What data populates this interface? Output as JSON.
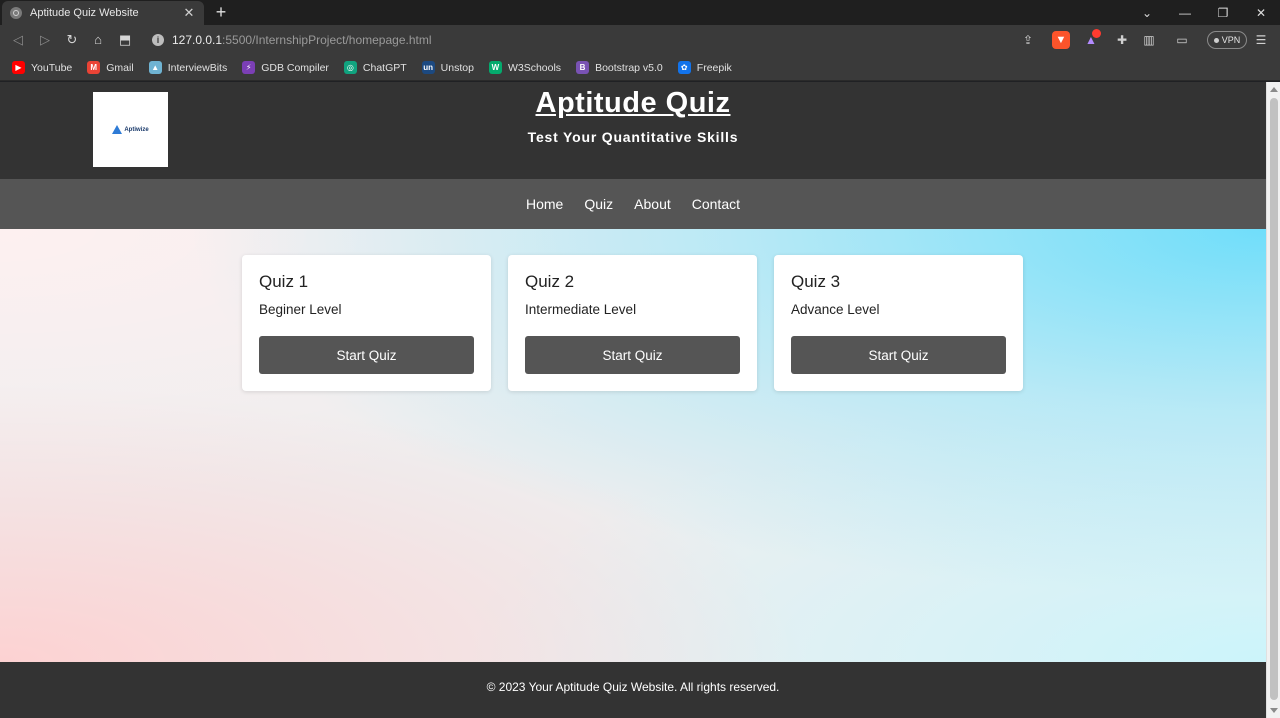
{
  "browser": {
    "tab_title": "Aptitude Quiz Website",
    "tab_close": "✕",
    "new_tab": "+",
    "url_host": "127.0.0.1",
    "url_rest": ":5500/InternshipProject/homepage.html",
    "vpn_label": "VPN",
    "bookmarks": [
      {
        "label": "YouTube",
        "icon": "youtube-icon",
        "color": "#ff0000"
      },
      {
        "label": "Gmail",
        "icon": "gmail-icon",
        "color": "#ea4335"
      },
      {
        "label": "InterviewBits",
        "icon": "interviewbit-icon",
        "color": "#6fb3d2"
      },
      {
        "label": "GDB Compiler",
        "icon": "gdb-icon",
        "color": "#7b3fb5"
      },
      {
        "label": "ChatGPT",
        "icon": "chatgpt-icon",
        "color": "#10a37f"
      },
      {
        "label": "Unstop",
        "icon": "unstop-icon",
        "color": "#1c4980"
      },
      {
        "label": "W3Schools",
        "icon": "w3schools-icon",
        "color": "#04aa6d"
      },
      {
        "label": "Bootstrap v5.0",
        "icon": "bootstrap-icon",
        "color": "#7952b3"
      },
      {
        "label": "Freepik",
        "icon": "freepik-icon",
        "color": "#1273eb"
      }
    ]
  },
  "site": {
    "logo_text": "Aptiwize",
    "title": "Aptitude Quiz",
    "subtitle": "Test Your Quantitative Skills",
    "nav": [
      "Home",
      "Quiz",
      "About",
      "Contact"
    ],
    "quizzes": [
      {
        "title": "Quiz 1",
        "level": "Beginer Level",
        "button": "Start Quiz"
      },
      {
        "title": "Quiz 2",
        "level": "Intermediate Level",
        "button": "Start Quiz"
      },
      {
        "title": "Quiz 3",
        "level": "Advance Level",
        "button": "Start Quiz"
      }
    ],
    "footer": "© 2023 Your Aptitude Quiz Website. All rights reserved."
  },
  "colors": {
    "header_bg": "#333333",
    "nav_bg": "#555555",
    "button_bg": "#555555"
  }
}
